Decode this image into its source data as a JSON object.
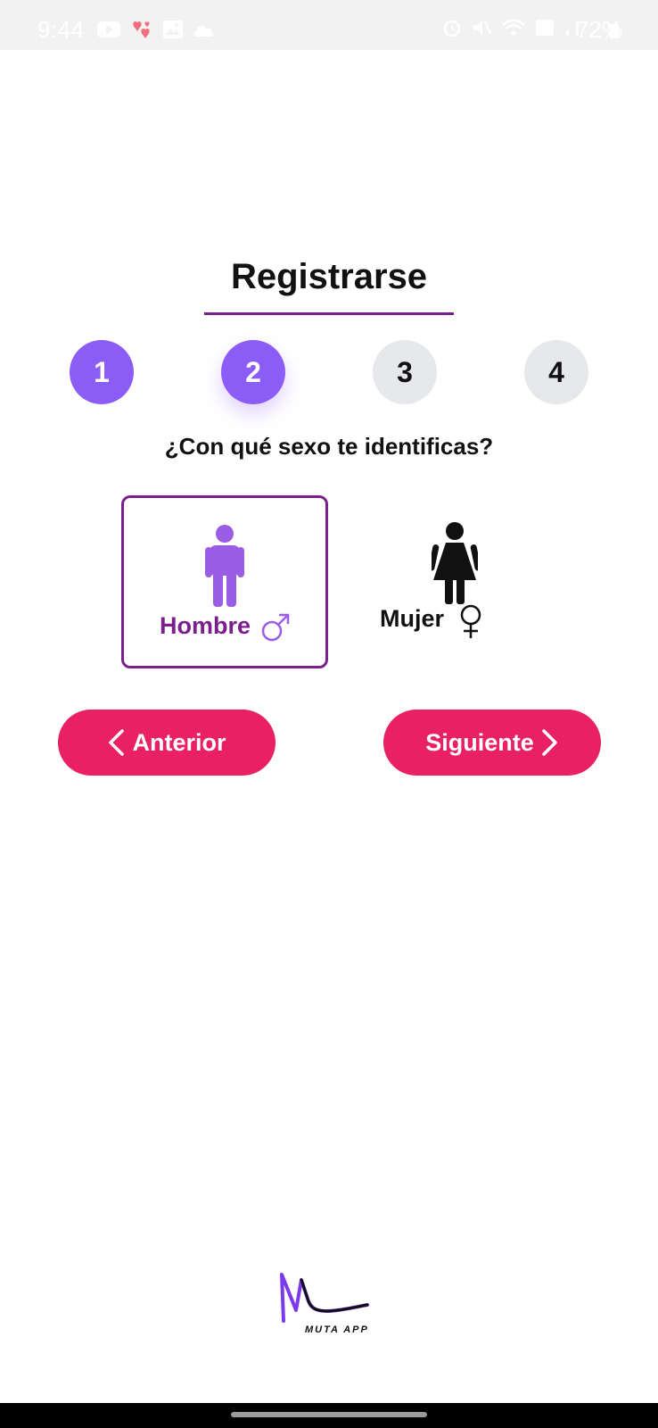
{
  "status_bar": {
    "time": "9:44",
    "battery": "72%",
    "left_icons": [
      "youtube-icon",
      "hearts-icon",
      "image-icon",
      "cloud-icon"
    ],
    "right_icons": [
      "alarm-icon",
      "mute-icon",
      "wifi-icon",
      "volte-icon",
      "signal-icon",
      "battery-icon"
    ]
  },
  "title": "Registrarse",
  "stepper": {
    "steps": [
      "1",
      "2",
      "3",
      "4"
    ],
    "current_step": 2,
    "active_color": "#8b5cf6",
    "inactive_color": "#e7e8ec"
  },
  "question": "¿Con qué sexo te identificas?",
  "options": {
    "male": {
      "label": "Hombre",
      "symbol": "♂",
      "icon": "man-icon",
      "selected": true
    },
    "female": {
      "label": "Mujer",
      "symbol": "♀",
      "icon": "woman-icon",
      "selected": false
    }
  },
  "buttons": {
    "previous": "Anterior",
    "next": "Siguiente"
  },
  "logo": {
    "text": "MUTA APP"
  },
  "colors": {
    "accent_purple": "#8b5cf6",
    "selected_border": "#7a1f8c",
    "button_pink": "#ea2064"
  }
}
